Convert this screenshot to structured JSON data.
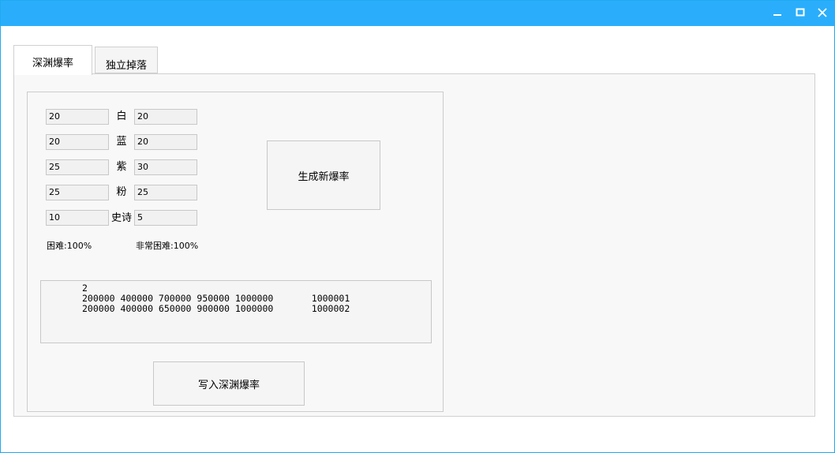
{
  "tabs": [
    {
      "label": "深渊爆率",
      "active": true
    },
    {
      "label": "独立掉落",
      "active": false
    }
  ],
  "rows": [
    {
      "left": "20",
      "label": "白",
      "right": "20"
    },
    {
      "left": "20",
      "label": "蓝",
      "right": "20"
    },
    {
      "left": "25",
      "label": "紫",
      "right": "30"
    },
    {
      "left": "25",
      "label": "粉",
      "right": "25"
    },
    {
      "left": "10",
      "label": "史诗",
      "right": "5"
    }
  ],
  "hard_label": "困难:100%",
  "very_hard_label": "非常困难:100%",
  "generate_button": "生成新爆率",
  "output_text": "2\n200000 400000 700000 950000 1000000       1000001\n200000 400000 650000 900000 1000000       1000002",
  "write_button": "写入深渊爆率",
  "colors": {
    "titlebar": "#2aaefb",
    "border": "#1eaaf1"
  },
  "icons": {
    "minimize": "minimize-icon",
    "maximize": "maximize-icon",
    "close": "close-icon"
  }
}
